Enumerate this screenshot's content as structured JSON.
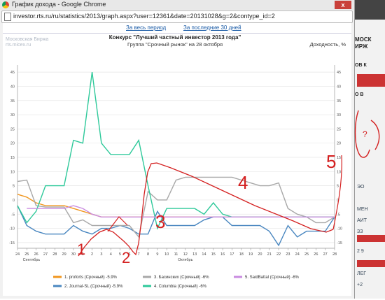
{
  "window": {
    "title": "График дохода - Google Chrome",
    "url": "investor.rts.ru/ru/statistics/2013/graph.aspx?user=12361&date=20131028&g=2&contype_id=2",
    "close_label": "x"
  },
  "periods": {
    "all": "За весь период",
    "last30": "За последние 30 дней"
  },
  "watermark": [
    "Московская Биржа",
    "rts.micex.ru"
  ],
  "background_page": {
    "snippets": [
      "МОСК",
      "ИРЖ",
      "ОВ К",
      "О В",
      "ЭО",
      "МЕН",
      "АИТ",
      "ЗЗ",
      "2 9",
      "ЛЕГ",
      "+2"
    ]
  },
  "chart_data": {
    "type": "line",
    "title": "Конкурс \"Лучший частный инвестор 2013 года\"",
    "subtitle": "Группа \"Срочный рынок\" на 28 октября",
    "ylabel": "Доходность, %",
    "ylim": [
      -17,
      47
    ],
    "yticks": [
      45,
      40,
      35,
      30,
      25,
      20,
      15,
      10,
      5,
      0,
      -5,
      -10,
      -15
    ],
    "xticks": [
      "24",
      "25",
      "26",
      "27",
      "28",
      "29",
      "30",
      "1",
      "2",
      "3",
      "4",
      "5",
      "6",
      "7",
      "8",
      "9",
      "10",
      "11",
      "12",
      "13",
      "14",
      "15",
      "16",
      "17",
      "18",
      "19",
      "20",
      "21",
      "22",
      "23",
      "24",
      "25",
      "26",
      "27",
      "28"
    ],
    "month_labels": [
      {
        "label": "Сентябрь",
        "at": 1.5
      },
      {
        "label": "Октябрь",
        "at": 18
      }
    ],
    "grid": true,
    "legend_position": "bottom",
    "series": [
      {
        "name": "1. proforts (Срочный)  -5.9%",
        "color": "#f0961e",
        "values": [
          2,
          1,
          -1,
          -2,
          -2,
          -2,
          -3,
          -4,
          -5,
          -6,
          -6,
          -6,
          -6,
          -6,
          -6,
          -6,
          -6,
          -6,
          -6,
          -6,
          -6,
          -6,
          -6,
          -6,
          -6,
          -6,
          -6,
          -6,
          -6,
          -6,
          -6,
          -6,
          -6,
          -6,
          -6
        ]
      },
      {
        "name": "2. Journal-SL (Срочный)  -5.9%",
        "color": "#4a87c0",
        "values": [
          -2,
          -9,
          -11,
          -12,
          -12,
          -12,
          -9,
          -11,
          -12,
          -10,
          -10,
          -9,
          -10,
          -12,
          -12,
          -4,
          -9,
          -9,
          -9,
          -9,
          -7,
          -6,
          -6,
          -9,
          -9,
          -9,
          -9,
          -11,
          -16,
          -9,
          -13,
          -11,
          -11,
          -11,
          -6
        ]
      },
      {
        "name": "3. Басинских (Срочный)  -6%",
        "color": "#a8a8a8",
        "values": [
          6.5,
          7,
          -2,
          -2.5,
          -2.5,
          -2.5,
          -8,
          -7,
          -9,
          -9,
          -9,
          -9,
          -9,
          -13,
          3,
          0,
          0,
          7,
          8,
          8,
          8,
          8,
          8,
          8,
          7,
          6,
          5,
          5,
          6,
          -3,
          -5,
          -6,
          -8,
          -8,
          -6
        ]
      },
      {
        "name": "4. Columbia (Срочный)  -6%",
        "color": "#2ec99a",
        "values": [
          -2,
          -8,
          -4,
          5,
          5,
          5,
          21,
          20,
          45,
          20,
          16,
          16,
          16,
          21,
          5,
          -10,
          -3,
          -3,
          -3,
          -3,
          -5,
          -1,
          -5,
          -6,
          -6,
          -6,
          -6,
          -6,
          -6,
          -6,
          -6,
          -6,
          -6,
          -6,
          -6
        ]
      },
      {
        "name": "5. SaidBattal (Срочный)  -6%",
        "color": "#c98be0",
        "values": [
          null,
          -3,
          -3,
          -3,
          -3,
          -3,
          -2,
          -3,
          -5,
          -6,
          -6,
          -6,
          -6,
          -6,
          -6,
          -6,
          -6,
          -6,
          -6,
          -6,
          -6,
          -6,
          -6,
          -6,
          -6,
          -6,
          -6,
          -6,
          -6,
          -6,
          -6,
          -6,
          -6,
          -6,
          -6
        ]
      }
    ],
    "annotations": [
      "1",
      "2",
      "3",
      "4",
      "5",
      "?"
    ]
  }
}
